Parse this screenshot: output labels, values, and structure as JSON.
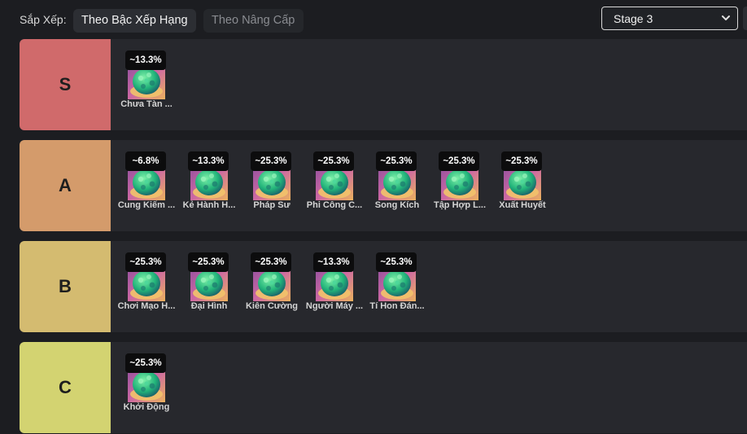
{
  "sort": {
    "label": "Sắp Xếp:",
    "options": [
      "Theo Bậc Xếp Hạng",
      "Theo Nâng Cấp"
    ],
    "active": "Theo Bậc Xếp Hạng"
  },
  "stage_select": {
    "value": "Stage 3"
  },
  "colors": {
    "tier_S": "#d06a6b",
    "tier_A": "#d49b6b",
    "tier_B": "#d4bb70",
    "tier_C": "#d3d371",
    "row_bg": "#27282d",
    "page_bg": "#1c1d21"
  },
  "tiers": [
    {
      "label": "S",
      "items": [
        {
          "rate": "~13.3%",
          "name": "Chưa Tàn ..."
        }
      ]
    },
    {
      "label": "A",
      "items": [
        {
          "rate": "~6.8%",
          "name": "Cung Kiếm ..."
        },
        {
          "rate": "~13.3%",
          "name": "Kẻ Hành H..."
        },
        {
          "rate": "~25.3%",
          "name": "Pháp Sư"
        },
        {
          "rate": "~25.3%",
          "name": "Phi Công C..."
        },
        {
          "rate": "~25.3%",
          "name": "Song Kích"
        },
        {
          "rate": "~25.3%",
          "name": "Tập Hợp L..."
        },
        {
          "rate": "~25.3%",
          "name": "Xuất Huyết"
        }
      ]
    },
    {
      "label": "B",
      "items": [
        {
          "rate": "~25.3%",
          "name": "Chơi Mạo H..."
        },
        {
          "rate": "~25.3%",
          "name": "Đại Hình"
        },
        {
          "rate": "~25.3%",
          "name": "Kiên Cường"
        },
        {
          "rate": "~13.3%",
          "name": "Người Máy ..."
        },
        {
          "rate": "~25.3%",
          "name": "Tí Hon Đán..."
        }
      ]
    },
    {
      "label": "C",
      "items": [
        {
          "rate": "~25.3%",
          "name": "Khởi Động"
        }
      ]
    }
  ],
  "item_icon": "augment-orb-icon"
}
